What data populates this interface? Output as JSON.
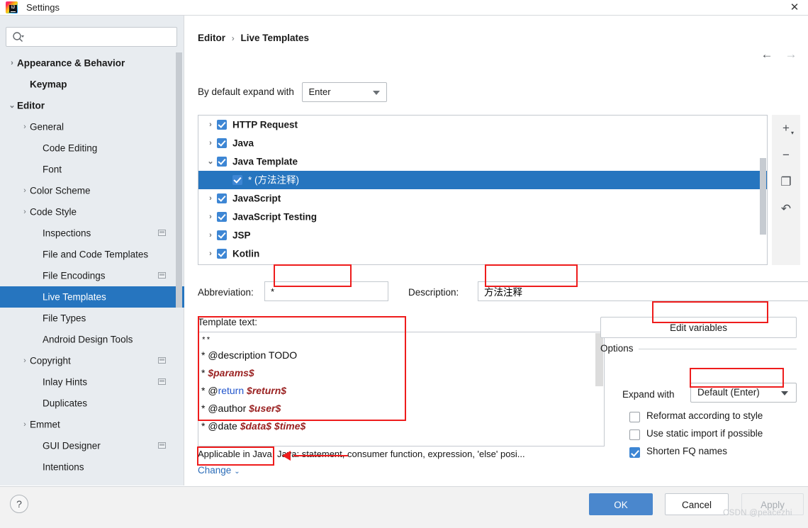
{
  "window": {
    "title": "Settings",
    "logo_icon": "intellij-idea-logo",
    "close_icon": "close-icon"
  },
  "sidebar": {
    "search": {
      "placeholder": "",
      "value": "",
      "icon": "search-icon"
    },
    "items": [
      {
        "label": "Appearance & Behavior",
        "arrow": "›",
        "indent": 0,
        "bold": true,
        "selected": false,
        "badge": false
      },
      {
        "label": "Keymap",
        "arrow": "",
        "indent": 1,
        "bold": true,
        "selected": false,
        "badge": false
      },
      {
        "label": "Editor",
        "arrow": "⌄",
        "indent": 0,
        "bold": true,
        "selected": false,
        "badge": false
      },
      {
        "label": "General",
        "arrow": "›",
        "indent": 1,
        "bold": false,
        "selected": false,
        "badge": false
      },
      {
        "label": "Code Editing",
        "arrow": "",
        "indent": 2,
        "bold": false,
        "selected": false,
        "badge": false
      },
      {
        "label": "Font",
        "arrow": "",
        "indent": 2,
        "bold": false,
        "selected": false,
        "badge": false
      },
      {
        "label": "Color Scheme",
        "arrow": "›",
        "indent": 1,
        "bold": false,
        "selected": false,
        "badge": false
      },
      {
        "label": "Code Style",
        "arrow": "›",
        "indent": 1,
        "bold": false,
        "selected": false,
        "badge": false
      },
      {
        "label": "Inspections",
        "arrow": "",
        "indent": 2,
        "bold": false,
        "selected": false,
        "badge": true
      },
      {
        "label": "File and Code Templates",
        "arrow": "",
        "indent": 2,
        "bold": false,
        "selected": false,
        "badge": false
      },
      {
        "label": "File Encodings",
        "arrow": "",
        "indent": 2,
        "bold": false,
        "selected": false,
        "badge": true
      },
      {
        "label": "Live Templates",
        "arrow": "",
        "indent": 2,
        "bold": false,
        "selected": true,
        "badge": false
      },
      {
        "label": "File Types",
        "arrow": "",
        "indent": 2,
        "bold": false,
        "selected": false,
        "badge": false
      },
      {
        "label": "Android Design Tools",
        "arrow": "",
        "indent": 2,
        "bold": false,
        "selected": false,
        "badge": false
      },
      {
        "label": "Copyright",
        "arrow": "›",
        "indent": 1,
        "bold": false,
        "selected": false,
        "badge": true
      },
      {
        "label": "Inlay Hints",
        "arrow": "",
        "indent": 2,
        "bold": false,
        "selected": false,
        "badge": true
      },
      {
        "label": "Duplicates",
        "arrow": "",
        "indent": 2,
        "bold": false,
        "selected": false,
        "badge": false
      },
      {
        "label": "Emmet",
        "arrow": "›",
        "indent": 1,
        "bold": false,
        "selected": false,
        "badge": false
      },
      {
        "label": "GUI Designer",
        "arrow": "",
        "indent": 2,
        "bold": false,
        "selected": false,
        "badge": true
      },
      {
        "label": "Intentions",
        "arrow": "",
        "indent": 2,
        "bold": false,
        "selected": false,
        "badge": false
      }
    ]
  },
  "main": {
    "breadcrumb": {
      "root": "Editor",
      "separator": "›",
      "leaf": "Live Templates"
    },
    "nav": {
      "back_icon": "arrow-left-icon",
      "forward_icon": "arrow-right-icon"
    },
    "expand_default": {
      "label": "By default expand with",
      "value": "Enter"
    },
    "templates_tree": [
      {
        "label": "HTTP Request",
        "arrow": "›",
        "checked": true,
        "child": false,
        "selected": false
      },
      {
        "label": "Java",
        "arrow": "›",
        "checked": true,
        "child": false,
        "selected": false
      },
      {
        "label": "Java Template",
        "arrow": "⌄",
        "checked": true,
        "child": false,
        "selected": false
      },
      {
        "label": "* (方法注释)",
        "arrow": "",
        "checked": true,
        "child": true,
        "selected": true
      },
      {
        "label": "JavaScript",
        "arrow": "›",
        "checked": true,
        "child": false,
        "selected": false
      },
      {
        "label": "JavaScript Testing",
        "arrow": "›",
        "checked": true,
        "child": false,
        "selected": false
      },
      {
        "label": "JSP",
        "arrow": "›",
        "checked": true,
        "child": false,
        "selected": false
      },
      {
        "label": "Kotlin",
        "arrow": "›",
        "checked": true,
        "child": false,
        "selected": false
      }
    ],
    "tree_toolbar": [
      {
        "icon": "add-icon",
        "glyph": "+"
      },
      {
        "icon": "remove-icon",
        "glyph": "−"
      },
      {
        "icon": "copy-icon",
        "glyph": "❐"
      },
      {
        "icon": "revert-icon",
        "glyph": "↶"
      }
    ],
    "abbreviation": {
      "label": "Abbreviation:",
      "value": "*"
    },
    "description": {
      "label": "Description:",
      "value": "方法注释"
    },
    "template_text": {
      "label": "Template text:",
      "lines": [
        {
          "first": true,
          "parts": [
            {
              "text": "**",
              "style": "plain"
            }
          ]
        },
        {
          "first": false,
          "parts": [
            {
              "text": "* @description TODO",
              "style": "plain"
            }
          ]
        },
        {
          "first": false,
          "parts": [
            {
              "text": "* ",
              "style": "plain"
            },
            {
              "text": "$params$",
              "style": "var"
            }
          ]
        },
        {
          "first": false,
          "parts": [
            {
              "text": "* @",
              "style": "plain"
            },
            {
              "text": "return",
              "style": "tag"
            },
            {
              "text": " ",
              "style": "plain"
            },
            {
              "text": "$return$",
              "style": "var"
            }
          ]
        },
        {
          "first": false,
          "parts": [
            {
              "text": "* @author ",
              "style": "plain"
            },
            {
              "text": "$user$",
              "style": "var"
            }
          ]
        },
        {
          "first": false,
          "parts": [
            {
              "text": "* @date ",
              "style": "plain"
            },
            {
              "text": "$data$ $time$",
              "style": "var"
            }
          ]
        }
      ]
    },
    "edit_variables_label": "Edit variables",
    "options": {
      "title": "Options",
      "expand_with": {
        "label": "Expand with",
        "value": "Default (Enter)"
      },
      "checkboxes": [
        {
          "label": "Reformat according to style",
          "checked": false
        },
        {
          "label": "Use static import if possible",
          "checked": false
        },
        {
          "label": "Shorten FQ names",
          "checked": true
        }
      ]
    },
    "applicable_text": "Applicable in Java; Java: statement, consumer function, expression, 'else' posi...",
    "change_label": "Change",
    "change_chevron": "⌄"
  },
  "footer": {
    "help_label": "?",
    "ok_label": "OK",
    "cancel_label": "Cancel",
    "apply_label": "Apply",
    "watermark": "CSDN @peacezhi"
  },
  "colors": {
    "accent_blue": "#2675bf",
    "button_blue": "#4a87cd",
    "annotation_red": "#ee1c1c",
    "checkbox_blue": "#3d86d4",
    "link_blue": "#2b6cb8",
    "sidebar_bg": "#e8ecf0"
  }
}
